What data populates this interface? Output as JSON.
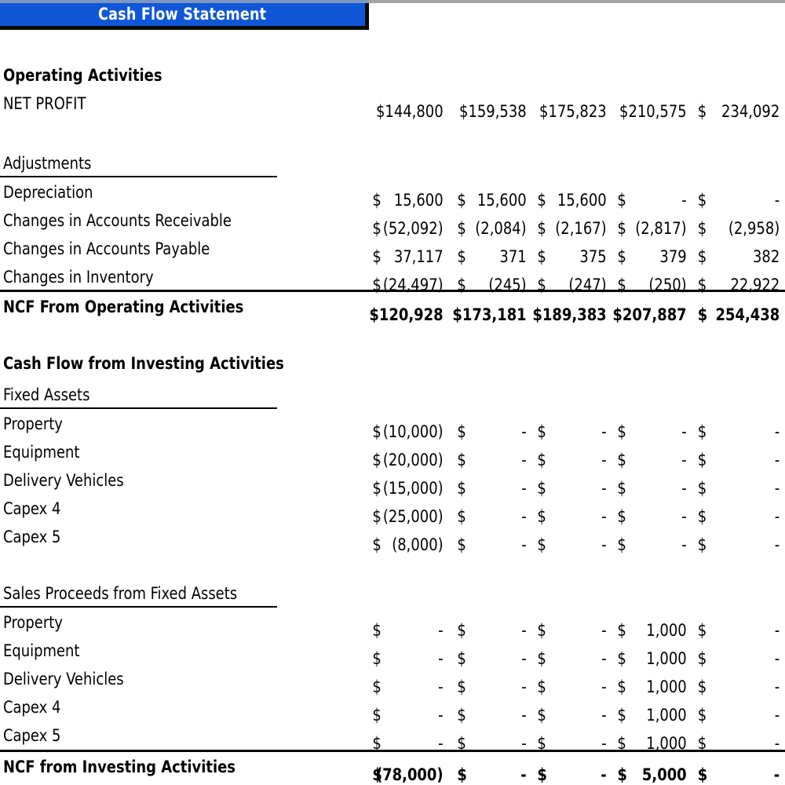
{
  "header": {
    "title": "Cash Flow Statement",
    "banner_color": "#1057D8",
    "banner_text_color": "#FFFFFF"
  },
  "sections": {
    "operating": {
      "heading": "Operating Activities",
      "net_profit_label": "NET PROFIT",
      "adjustments_heading": "Adjustments",
      "total_label": "NCF From Operating Activities",
      "rows": [
        {
          "label": "Depreciation"
        },
        {
          "label": "Changes in Accounts Receivable"
        },
        {
          "label": "Changes in Accounts Payable"
        },
        {
          "label": "Changes in Inventory"
        }
      ]
    },
    "investing": {
      "heading": "Cash Flow from Investing Activities",
      "fixed_assets_heading": "Fixed Assets",
      "sales_proceeds_heading": "Sales Proceeds from Fixed Assets",
      "total_label": "NCF from Investing Activities",
      "asset_rows": [
        {
          "label": "Property"
        },
        {
          "label": "Equipment"
        },
        {
          "label": "Delivery Vehicles"
        },
        {
          "label": "Capex 4"
        },
        {
          "label": "Capex 5"
        }
      ]
    }
  },
  "values": {
    "net_profit": [
      "$144,800",
      "$159,538",
      "$175,823",
      "$210,575",
      "234,092"
    ],
    "depreciation": [
      "15,600",
      "15,600",
      "15,600",
      "-",
      "-"
    ],
    "ar_changes": [
      "(52,092)",
      "(2,084)",
      "(2,167)",
      "(2,817)",
      "(2,958)"
    ],
    "ap_changes": [
      "37,117",
      "371",
      "375",
      "379",
      "382"
    ],
    "inventory": [
      "(24,497)",
      "(245)",
      "(247)",
      "(250)",
      "22,922"
    ],
    "ncf_operating": [
      "$120,928",
      "$173,181",
      "$189,383",
      "$207,887",
      "254,438"
    ],
    "capex_property": [
      "(10,000)",
      "-",
      "-",
      "-",
      "-"
    ],
    "capex_equipment": [
      "(20,000)",
      "-",
      "-",
      "-",
      "-"
    ],
    "capex_vehicles": [
      "(15,000)",
      "-",
      "-",
      "-",
      "-"
    ],
    "capex_4": [
      "(25,000)",
      "-",
      "-",
      "-",
      "-"
    ],
    "capex_5": [
      "(8,000)",
      "-",
      "-",
      "-",
      "-"
    ],
    "proceeds_property": [
      "-",
      "-",
      "-",
      "1,000",
      "-"
    ],
    "proceeds_equipment": [
      "-",
      "-",
      "-",
      "1,000",
      "-"
    ],
    "proceeds_vehicles": [
      "-",
      "-",
      "-",
      "1,000",
      "-"
    ],
    "proceeds_capex_4": [
      "-",
      "-",
      "-",
      "1,000",
      "-"
    ],
    "proceeds_capex_5": [
      "-",
      "-",
      "-",
      "1,000",
      "-"
    ],
    "ncf_investing": [
      "(78,000)",
      "-",
      "-",
      "5,000",
      "-"
    ]
  },
  "currency_symbol": "$",
  "column_count": 5
}
